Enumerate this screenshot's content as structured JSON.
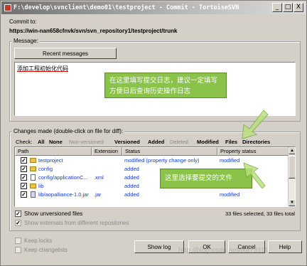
{
  "window": {
    "title": "F:\\develop\\svnclient\\demo01\\testproject - Commit - TortoiseSVN",
    "min_glyph": "_",
    "max_glyph": "□",
    "close_glyph": "X"
  },
  "commit": {
    "label": "Commit to:",
    "url": "https://win-nan658cfnvk/svn/svn_repository1/testproject/trunk"
  },
  "message": {
    "group_label": "Message:",
    "recent_button": "Recent messages",
    "text": "添加工程初始化代码",
    "callout": "在这里填写提交日志，建议一定填写方便日后查询历史操作日志"
  },
  "changes": {
    "group_label": "Changes made (double-click on file for diff):",
    "check_label": "Check:",
    "filters": [
      "All",
      "None",
      "Non-versioned",
      "Versioned",
      "Added",
      "Deleted",
      "Modified",
      "Files",
      "Directories"
    ],
    "columns": [
      "Path",
      "Extension",
      "Status",
      "Property status"
    ],
    "rows": [
      {
        "path": "testproject",
        "ext": "",
        "status": "modified (property change only)",
        "prop": "modified",
        "icon": "folder-icon"
      },
      {
        "path": "config",
        "ext": "",
        "status": "added",
        "prop": "",
        "icon": "folder-icon"
      },
      {
        "path": "config/applicationC...",
        "ext": ".xml",
        "status": "added",
        "prop": "",
        "icon": "file-icon"
      },
      {
        "path": "lib",
        "ext": "",
        "status": "added",
        "prop": "",
        "icon": "folder-icon"
      },
      {
        "path": "lib/aopalliance-1.0.jar",
        "ext": ".jar",
        "status": "added",
        "prop": "modified",
        "icon": "jar-icon"
      }
    ],
    "callout": "这里选择要提交的文件",
    "show_unversioned": "Show unversioned files",
    "show_externals": "Show externals from different repositories",
    "summary": "33 files selected, 33 files total"
  },
  "options": {
    "keep_locks": "Keep locks",
    "keep_changelists": "Keep changelists"
  },
  "buttons": {
    "show_log": "Show log",
    "ok": "OK",
    "cancel": "Cancel",
    "help": "Help"
  },
  "watermark": "http://blog.csdn.net/lx873111",
  "colors": {
    "callout_green": "#8ac24a",
    "link_blue": "#1a3fb8"
  }
}
